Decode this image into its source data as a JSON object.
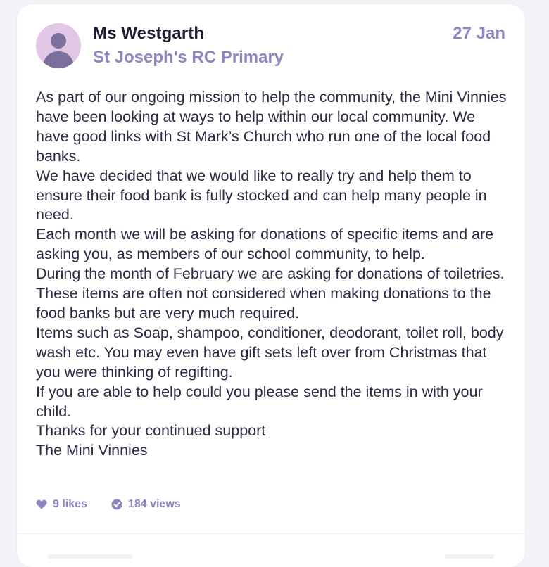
{
  "post": {
    "author": "Ms Westgarth",
    "school": "St Joseph's RC Primary",
    "date": "27 Jan",
    "avatar_icon": "person-silhouette-icon",
    "avatar_bg": "#e3c7e6",
    "accent_color": "#8b87c0",
    "paragraphs": [
      "As part of our ongoing mission to help the community, the Mini Vinnies have been looking at ways to help within our local community. We have good links with St Mark’s Church who run one of the local food banks.",
      "We have decided that we would like to really try and help them to ensure their food bank is fully stocked and can help many people in need.",
      "Each month we will be asking for donations of specific items and are asking you, as members of our school community, to help.",
      "During the month of February we are asking for donations of toiletries. These items are often not considered when making donations to the food banks but are very much required.",
      "Items such as Soap, shampoo, conditioner, deodorant, toilet roll, body wash etc. You may even have gift sets left over from Christmas that you were thinking of regifting.",
      "If you are able to help could you please send the items in with your child.",
      "Thanks for your continued support",
      "The Mini Vinnies"
    ],
    "likes": "9 likes",
    "views": "184 views"
  }
}
